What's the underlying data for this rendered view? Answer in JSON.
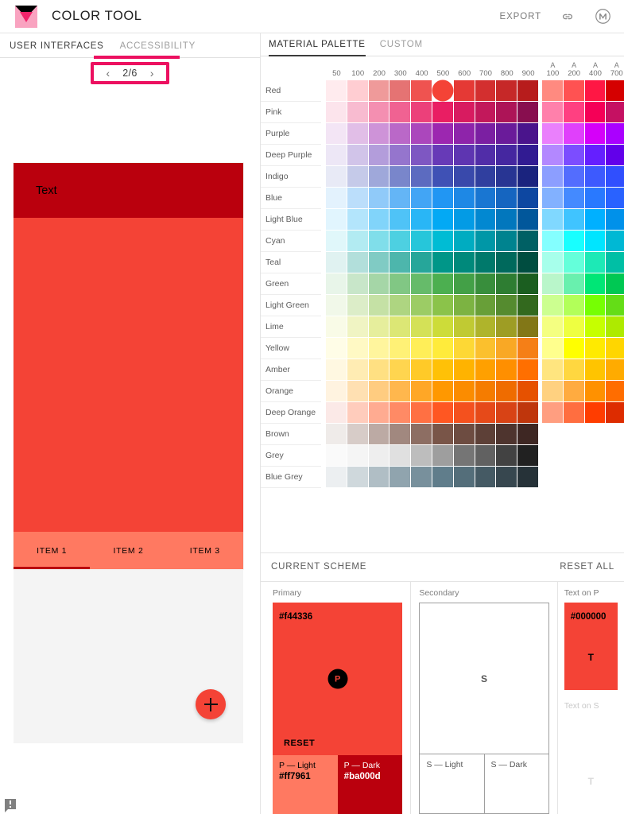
{
  "header": {
    "title": "COLOR TOOL",
    "export_label": "EXPORT",
    "link_icon": "link-icon",
    "material_icon": "material-logo-icon",
    "logo_icon": "material-color-tool-logo"
  },
  "left": {
    "tabs": [
      {
        "label": "USER INTERFACES",
        "active": true
      },
      {
        "label": "ACCESSIBILITY",
        "active": false
      }
    ],
    "pager": {
      "prev": "‹",
      "next": "›",
      "label": "2/6",
      "current": 2,
      "total": 6
    },
    "preview": {
      "appbar_text": "Text",
      "appbar_color": "#ba000d",
      "body_color": "#f44336",
      "tabbar_color": "#ff7961",
      "indicator_color": "#ba000d",
      "tabs": [
        "ITEM 1",
        "ITEM 2",
        "ITEM 3"
      ],
      "sheet_color": "#f4f4f4",
      "fab_color": "#f44336",
      "fab_icon": "plus-icon",
      "text_color": "#000000"
    },
    "feedback_icon": "feedback-icon"
  },
  "palette": {
    "tabs": [
      {
        "label": "MATERIAL PALETTE",
        "active": true
      },
      {
        "label": "CUSTOM",
        "active": false
      }
    ],
    "columns": [
      "50",
      "100",
      "200",
      "300",
      "400",
      "500",
      "600",
      "700",
      "800",
      "900"
    ],
    "accent_prefix": "A",
    "accent_columns": [
      "100",
      "200",
      "400",
      "700"
    ],
    "selected": {
      "row": "Red",
      "column": "500",
      "hex": "#f44336"
    },
    "rows": [
      {
        "name": "Red",
        "shades": [
          "#ffebee",
          "#ffcdd2",
          "#ef9a9a",
          "#e57373",
          "#ef5350",
          "#f44336",
          "#e53935",
          "#d32f2f",
          "#c62828",
          "#b71c1c"
        ],
        "accents": [
          "#ff8a80",
          "#ff5252",
          "#ff1744",
          "#d50000"
        ]
      },
      {
        "name": "Pink",
        "shades": [
          "#fce4ec",
          "#f8bbd0",
          "#f48fb1",
          "#f06292",
          "#ec407a",
          "#e91e63",
          "#d81b60",
          "#c2185b",
          "#ad1457",
          "#880e4f"
        ],
        "accents": [
          "#ff80ab",
          "#ff4081",
          "#f50057",
          "#c51162"
        ]
      },
      {
        "name": "Purple",
        "shades": [
          "#f3e5f5",
          "#e1bee7",
          "#ce93d8",
          "#ba68c8",
          "#ab47bc",
          "#9c27b0",
          "#8e24aa",
          "#7b1fa2",
          "#6a1b9a",
          "#4a148c"
        ],
        "accents": [
          "#ea80fc",
          "#e040fb",
          "#d500f9",
          "#aa00ff"
        ]
      },
      {
        "name": "Deep Purple",
        "shades": [
          "#ede7f6",
          "#d1c4e9",
          "#b39ddb",
          "#9575cd",
          "#7e57c2",
          "#673ab7",
          "#5e35b1",
          "#512da8",
          "#4527a0",
          "#311b92"
        ],
        "accents": [
          "#b388ff",
          "#7c4dff",
          "#651fff",
          "#6200ea"
        ]
      },
      {
        "name": "Indigo",
        "shades": [
          "#e8eaf6",
          "#c5cae9",
          "#9fa8da",
          "#7986cb",
          "#5c6bc0",
          "#3f51b5",
          "#3949ab",
          "#303f9f",
          "#283593",
          "#1a237e"
        ],
        "accents": [
          "#8c9eff",
          "#536dfe",
          "#3d5afe",
          "#304ffe"
        ]
      },
      {
        "name": "Blue",
        "shades": [
          "#e3f2fd",
          "#bbdefb",
          "#90caf9",
          "#64b5f6",
          "#42a5f5",
          "#2196f3",
          "#1e88e5",
          "#1976d2",
          "#1565c0",
          "#0d47a1"
        ],
        "accents": [
          "#82b1ff",
          "#448aff",
          "#2979ff",
          "#2962ff"
        ]
      },
      {
        "name": "Light Blue",
        "shades": [
          "#e1f5fe",
          "#b3e5fc",
          "#81d4fa",
          "#4fc3f7",
          "#29b6f6",
          "#03a9f4",
          "#039be5",
          "#0288d1",
          "#0277bd",
          "#01579b"
        ],
        "accents": [
          "#80d8ff",
          "#40c4ff",
          "#00b0ff",
          "#0091ea"
        ]
      },
      {
        "name": "Cyan",
        "shades": [
          "#e0f7fa",
          "#b2ebf2",
          "#80deea",
          "#4dd0e1",
          "#26c6da",
          "#00bcd4",
          "#00acc1",
          "#0097a7",
          "#00838f",
          "#006064"
        ],
        "accents": [
          "#84ffff",
          "#18ffff",
          "#00e5ff",
          "#00b8d4"
        ]
      },
      {
        "name": "Teal",
        "shades": [
          "#e0f2f1",
          "#b2dfdb",
          "#80cbc4",
          "#4db6ac",
          "#26a69a",
          "#009688",
          "#00897b",
          "#00796b",
          "#00695c",
          "#004d40"
        ],
        "accents": [
          "#a7ffeb",
          "#64ffda",
          "#1de9b6",
          "#00bfa5"
        ]
      },
      {
        "name": "Green",
        "shades": [
          "#e8f5e9",
          "#c8e6c9",
          "#a5d6a7",
          "#81c784",
          "#66bb6a",
          "#4caf50",
          "#43a047",
          "#388e3c",
          "#2e7d32",
          "#1b5e20"
        ],
        "accents": [
          "#b9f6ca",
          "#69f0ae",
          "#00e676",
          "#00c853"
        ]
      },
      {
        "name": "Light Green",
        "shades": [
          "#f1f8e9",
          "#dcedc8",
          "#c5e1a5",
          "#aed581",
          "#9ccc65",
          "#8bc34a",
          "#7cb342",
          "#689f38",
          "#558b2f",
          "#33691e"
        ],
        "accents": [
          "#ccff90",
          "#b2ff59",
          "#76ff03",
          "#64dd17"
        ]
      },
      {
        "name": "Lime",
        "shades": [
          "#f9fbe7",
          "#f0f4c3",
          "#e6ee9c",
          "#dce775",
          "#d4e157",
          "#cddc39",
          "#c0ca33",
          "#afb42b",
          "#9e9d24",
          "#827717"
        ],
        "accents": [
          "#f4ff81",
          "#eeff41",
          "#c6ff00",
          "#aeea00"
        ]
      },
      {
        "name": "Yellow",
        "shades": [
          "#fffde7",
          "#fff9c4",
          "#fff59d",
          "#fff176",
          "#ffee58",
          "#ffeb3b",
          "#fdd835",
          "#fbc02d",
          "#f9a825",
          "#f57f17"
        ],
        "accents": [
          "#ffff8d",
          "#ffff00",
          "#ffea00",
          "#ffd600"
        ]
      },
      {
        "name": "Amber",
        "shades": [
          "#fff8e1",
          "#ffecb3",
          "#ffe082",
          "#ffd54f",
          "#ffca28",
          "#ffc107",
          "#ffb300",
          "#ffa000",
          "#ff8f00",
          "#ff6f00"
        ],
        "accents": [
          "#ffe57f",
          "#ffd740",
          "#ffc400",
          "#ffab00"
        ]
      },
      {
        "name": "Orange",
        "shades": [
          "#fff3e0",
          "#ffe0b2",
          "#ffcc80",
          "#ffb74d",
          "#ffa726",
          "#ff9800",
          "#fb8c00",
          "#f57c00",
          "#ef6c00",
          "#e65100"
        ],
        "accents": [
          "#ffd180",
          "#ffab40",
          "#ff9100",
          "#ff6d00"
        ]
      },
      {
        "name": "Deep Orange",
        "shades": [
          "#fbe9e7",
          "#ffccbc",
          "#ffab91",
          "#ff8a65",
          "#ff7043",
          "#ff5722",
          "#f4511e",
          "#e64a19",
          "#d84315",
          "#bf360c"
        ],
        "accents": [
          "#ff9e80",
          "#ff6e40",
          "#ff3d00",
          "#dd2c00"
        ]
      },
      {
        "name": "Brown",
        "shades": [
          "#efebe9",
          "#d7ccc8",
          "#bcaaa4",
          "#a1887f",
          "#8d6e63",
          "#795548",
          "#6d4c41",
          "#5d4037",
          "#4e342e",
          "#3e2723"
        ],
        "accents": []
      },
      {
        "name": "Grey",
        "shades": [
          "#fafafa",
          "#f5f5f5",
          "#eeeeee",
          "#e0e0e0",
          "#bdbdbd",
          "#9e9e9e",
          "#757575",
          "#616161",
          "#424242",
          "#212121"
        ],
        "accents": []
      },
      {
        "name": "Blue Grey",
        "shades": [
          "#eceff1",
          "#cfd8dc",
          "#b0bec5",
          "#90a4ae",
          "#78909c",
          "#607d8b",
          "#546e7a",
          "#455a64",
          "#37474f",
          "#263238"
        ],
        "accents": []
      }
    ]
  },
  "scheme": {
    "title": "CURRENT SCHEME",
    "reset_all_label": "RESET ALL",
    "primary": {
      "label": "Primary",
      "hex": "#f44336",
      "badge": "P",
      "reset_label": "RESET",
      "light": {
        "name": "P — Light",
        "hex": "#ff7961"
      },
      "dark": {
        "name": "P — Dark",
        "hex": "#ba000d"
      }
    },
    "secondary": {
      "label": "Secondary",
      "badge": "S",
      "light_name": "S — Light",
      "dark_name": "S — Dark"
    },
    "text_on_primary": {
      "label": "Text on P",
      "hex": "#000000",
      "glyph": "T",
      "bg": "#f44336"
    },
    "text_on_secondary": {
      "label": "Text on S",
      "glyph": "T"
    }
  }
}
